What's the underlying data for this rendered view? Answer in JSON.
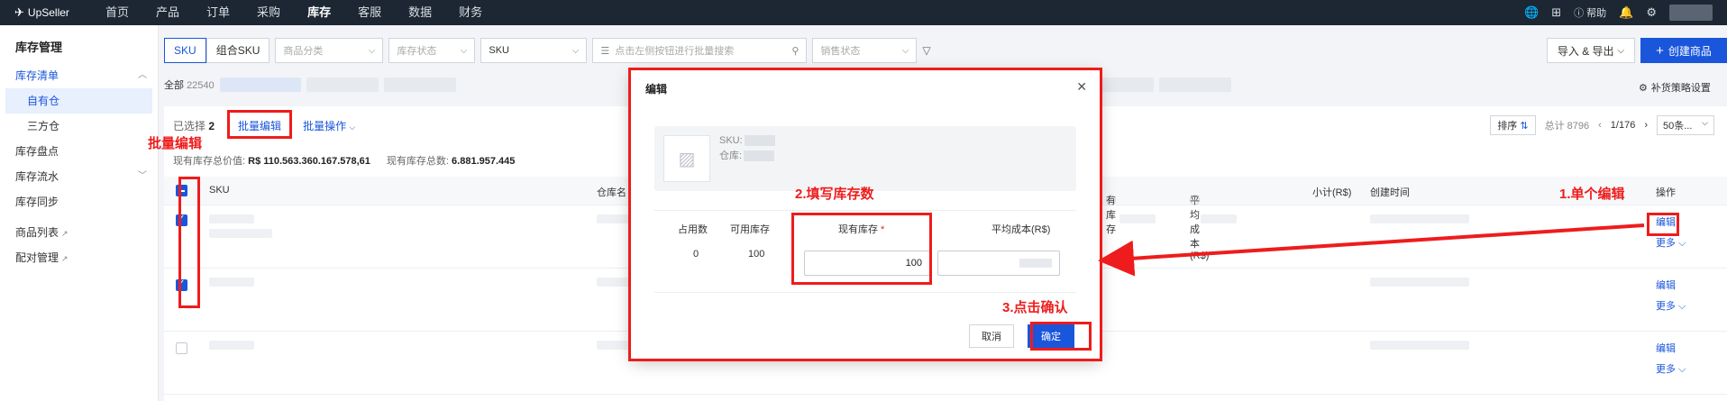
{
  "topbar": {
    "brand": "UpSeller",
    "nav": [
      "首页",
      "产品",
      "订单",
      "采购",
      "库存",
      "客服",
      "数据",
      "财务"
    ],
    "active_nav": 4,
    "help_label": "帮助"
  },
  "sidebar": {
    "title": "库存管理",
    "items": {
      "inventory_list": "库存清单",
      "own_warehouse": "自有仓",
      "third_party": "三方仓",
      "stocktake": "库存盘点",
      "flow": "库存流水",
      "sync": "库存同步",
      "product_list": "商品列表",
      "pairing": "配对管理"
    }
  },
  "filters": {
    "tab_sku": "SKU",
    "tab_combo": "组合SKU",
    "category_placeholder": "商品分类",
    "status_placeholder": "库存状态",
    "search_type": "SKU",
    "search_placeholder": "点击左侧按钮进行批量搜索",
    "sales_status_placeholder": "销售状态",
    "import_export": "导入 & 导出",
    "create_product": "创建商品"
  },
  "stats": {
    "all_label": "全部",
    "all_count": "22540",
    "restock_settings": "补货策略设置"
  },
  "toolbar": {
    "selected_prefix": "已选择",
    "selected_count": "2",
    "batch_edit": "批量编辑",
    "batch_ops": "批量操作",
    "total_value_label": "现有库存总价值:",
    "total_value": "R$ 110.563.360.167.578,61",
    "total_qty_label": "现有库存总数:",
    "total_qty": "6.881.957.445"
  },
  "pager": {
    "sort": "排序",
    "total": "总计 8796",
    "page": "1/176",
    "per_page": "50条..."
  },
  "table": {
    "headers": {
      "sku": "SKU",
      "warehouse": "仓库名",
      "stock": "有库存",
      "avg_cost": "平均成本(R$)",
      "subtotal": "小计(R$)",
      "created": "创建时间",
      "ops": "操作"
    },
    "row_edit": "编辑",
    "row_more": "更多"
  },
  "modal": {
    "title": "编辑",
    "sku_label": "SKU:",
    "wh_label": "仓库:",
    "col_occupied": "占用数",
    "col_available": "可用库存",
    "col_stock": "现有库存",
    "col_cost": "平均成本(R$)",
    "val_occupied": "0",
    "val_available": "100",
    "val_stock": "100",
    "cancel": "取消",
    "confirm": "确定"
  },
  "annotations": {
    "batch": "批量编辑",
    "step1": "1.单个编辑",
    "step2": "2.填写库存数",
    "step3": "3.点击确认"
  }
}
